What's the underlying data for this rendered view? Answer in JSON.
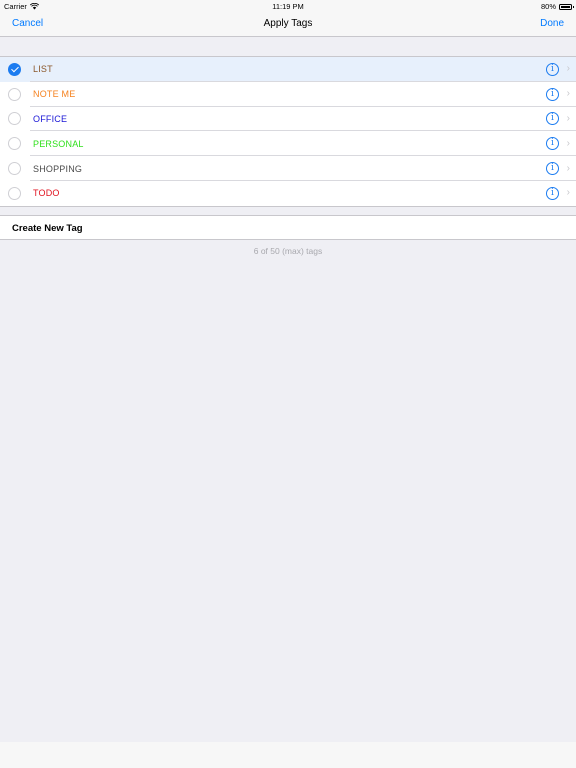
{
  "status_bar": {
    "carrier": "Carrier",
    "time": "11:19 PM",
    "battery": "80%"
  },
  "nav": {
    "cancel_label": "Cancel",
    "title": "Apply Tags",
    "done_label": "Done"
  },
  "tags": [
    {
      "label": "LIST",
      "color": "#8b572a",
      "selected": true
    },
    {
      "label": "NOTE ME",
      "color": "#f5821f",
      "selected": false
    },
    {
      "label": "OFFICE",
      "color": "#1a16d6",
      "selected": false
    },
    {
      "label": "PERSONAL",
      "color": "#2fe01b",
      "selected": false
    },
    {
      "label": "SHOPPING",
      "color": "#4a4a4a",
      "selected": false
    },
    {
      "label": "TODO",
      "color": "#e0121f",
      "selected": false
    }
  ],
  "create_tag_label": "Create New Tag",
  "footer_note": "6 of 50 (max) tags",
  "colors": {
    "accent": "#007aff",
    "background": "#efeff4",
    "selected_row": "#e7f0fc"
  }
}
